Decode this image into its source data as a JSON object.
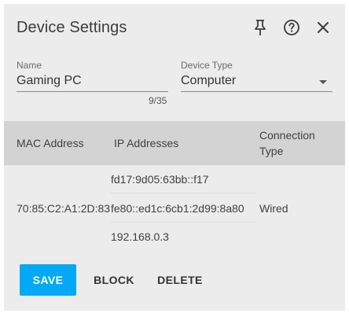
{
  "dialog": {
    "title": "Device Settings",
    "icons": {
      "pin": "pin-icon",
      "help": "help-circle-icon",
      "close": "close-icon"
    }
  },
  "form": {
    "name": {
      "label": "Name",
      "value": "Gaming PC",
      "counter": "9/35"
    },
    "device_type": {
      "label": "Device Type",
      "value": "Computer"
    }
  },
  "table": {
    "headers": {
      "mac": "MAC Address",
      "ip": "IP Addresses",
      "connection_line1": "Connection",
      "connection_line2": "Type"
    },
    "row": {
      "mac": "70:85:C2:A1:2D:83",
      "ips": [
        "fd17:9d05:63bb::f17",
        "fe80::ed1c:6cb1:2d99:8a80",
        "192.168.0.3"
      ],
      "connection": "Wired"
    }
  },
  "actions": {
    "save": "SAVE",
    "block": "BLOCK",
    "delete": "DELETE"
  },
  "colors": {
    "accent": "#03a9f4",
    "dialog_bg": "#ececec",
    "table_header_bg": "#d3d3d3"
  }
}
